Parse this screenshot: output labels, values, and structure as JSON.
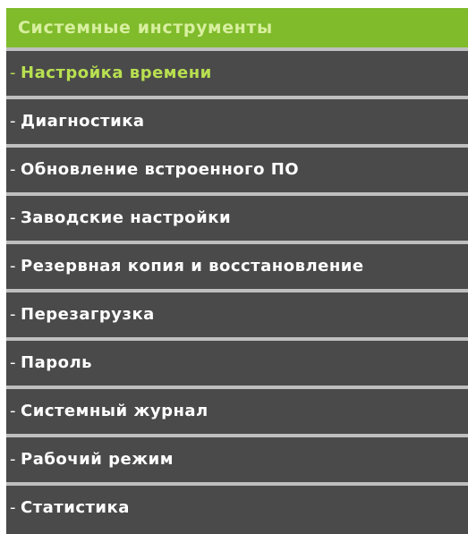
{
  "menu": {
    "header": "Системные инструменты",
    "dash": "-",
    "items": [
      {
        "label": "Настройка времени",
        "active": true
      },
      {
        "label": "Диагностика"
      },
      {
        "label": "Обновление встроенного ПО"
      },
      {
        "label": "Заводские настройки"
      },
      {
        "label": "Резервная копия и восстановление"
      },
      {
        "label": "Перезагрузка"
      },
      {
        "label": "Пароль"
      },
      {
        "label": "Системный журнал"
      },
      {
        "label": "Рабочий режим"
      },
      {
        "label": "Статистика"
      }
    ]
  },
  "colors": {
    "header_bg": "#7fbb2b",
    "header_text": "#d8ef9f",
    "item_bg": "#4a4a4a",
    "item_text": "#ffffff",
    "active_text": "#b8e050",
    "separator": "#bfbfbf"
  }
}
